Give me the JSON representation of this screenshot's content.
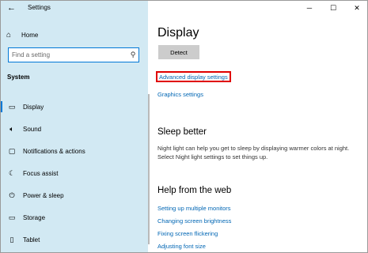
{
  "window": {
    "title": "Settings",
    "controls": {
      "minimize": "─",
      "maximize": "☐",
      "close": "✕"
    }
  },
  "sidebar": {
    "home_label": "Home",
    "search_placeholder": "Find a setting",
    "section_label": "System",
    "items": [
      {
        "label": "Display",
        "icon": "display-icon",
        "glyph": "▭",
        "active": true
      },
      {
        "label": "Sound",
        "icon": "sound-icon",
        "glyph": "🔈︎",
        "active": false
      },
      {
        "label": "Notifications & actions",
        "icon": "notifications-icon",
        "glyph": "▢",
        "active": false
      },
      {
        "label": "Focus assist",
        "icon": "focus-assist-icon",
        "glyph": "☾",
        "active": false
      },
      {
        "label": "Power & sleep",
        "icon": "power-icon",
        "glyph": "⏻",
        "active": false
      },
      {
        "label": "Storage",
        "icon": "storage-icon",
        "glyph": "▭",
        "active": false
      },
      {
        "label": "Tablet",
        "icon": "tablet-icon",
        "glyph": "▯",
        "active": false
      }
    ]
  },
  "main": {
    "title": "Display",
    "detect_label": "Detect",
    "advanced_link": "Advanced display settings",
    "graphics_link": "Graphics settings",
    "sleep_heading": "Sleep better",
    "sleep_text": "Night light can help you get to sleep by displaying warmer colors at night. Select Night light settings to set things up.",
    "help_heading": "Help from the web",
    "help_links": [
      "Setting up multiple monitors",
      "Changing screen brightness",
      "Fixing screen flickering",
      "Adjusting font size"
    ]
  },
  "colors": {
    "sidebar_bg": "#d2e9f3",
    "accent": "#0078d7",
    "link": "#0066b4",
    "highlight_border": "#e00000"
  }
}
